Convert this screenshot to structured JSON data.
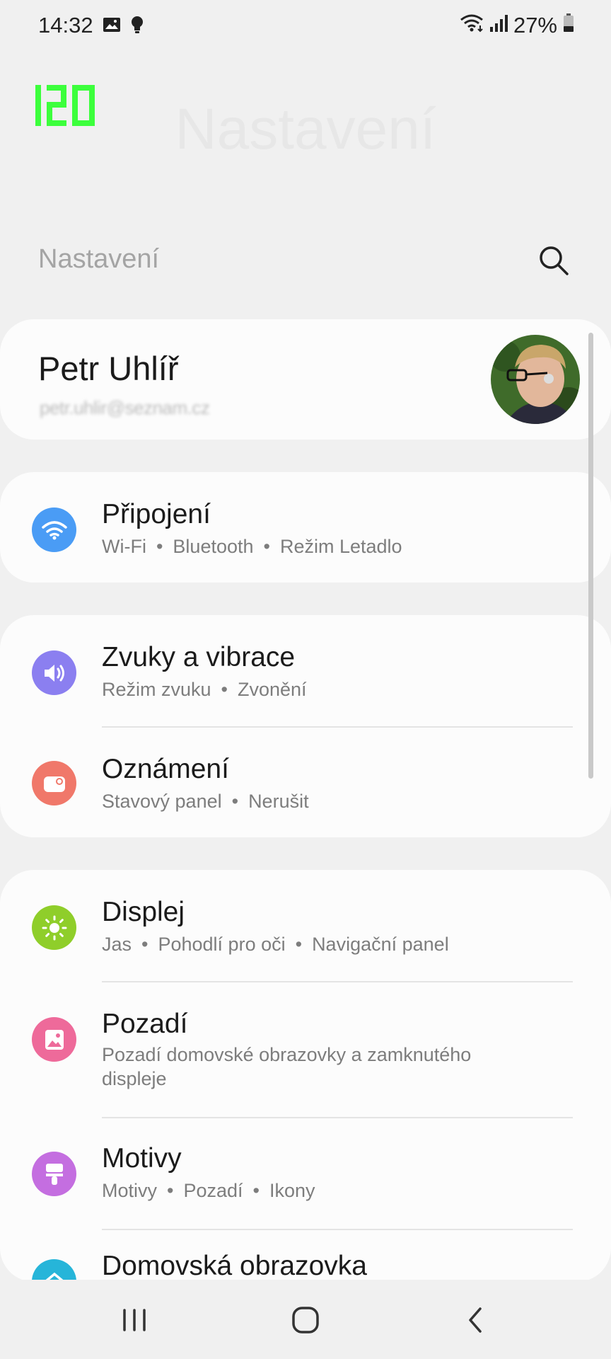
{
  "status_bar": {
    "time": "14:32",
    "battery_text": "27%",
    "left_icons": [
      "gallery-icon",
      "bulb-icon"
    ],
    "right_icons": [
      "wifi-icon",
      "signal-icon",
      "battery-icon"
    ]
  },
  "fps_counter": "120",
  "header": {
    "large_title": "Nastavení",
    "small_title": "Nastavení",
    "search_icon": "search-icon"
  },
  "profile": {
    "name": "Petr Uhlíř",
    "email": "petr.uhlir@seznam.cz"
  },
  "settings": [
    {
      "title": "Připojení",
      "subtitle_parts": [
        "Wi-Fi",
        "Bluetooth",
        "Režim Letadlo"
      ],
      "icon": "wifi-icon",
      "color": "#4a9cf5"
    },
    {
      "title": "Zvuky a vibrace",
      "subtitle_parts": [
        "Režim zvuku",
        "Zvonění"
      ],
      "icon": "volume-icon",
      "color": "#8b7ff0"
    },
    {
      "title": "Oznámení",
      "subtitle_parts": [
        "Stavový panel",
        "Nerušit"
      ],
      "icon": "notification-icon",
      "color": "#f0786a"
    },
    {
      "title": "Displej",
      "subtitle_parts": [
        "Jas",
        "Pohodlí pro oči",
        "Navigační panel"
      ],
      "icon": "brightness-icon",
      "color": "#8fce2a"
    },
    {
      "title": "Pozadí",
      "subtitle": "Pozadí domovské obrazovky a zamknutého displeje",
      "icon": "wallpaper-icon",
      "color": "#ee6a9a"
    },
    {
      "title": "Motivy",
      "subtitle_parts": [
        "Motivy",
        "Pozadí",
        "Ikony"
      ],
      "icon": "theme-icon",
      "color": "#c46ee0"
    },
    {
      "title": "Domovská obrazovka",
      "icon": "home-screen-icon",
      "color": "#26b5d9"
    }
  ],
  "nav": {
    "buttons": [
      "recents-icon",
      "home-icon",
      "back-icon"
    ]
  }
}
